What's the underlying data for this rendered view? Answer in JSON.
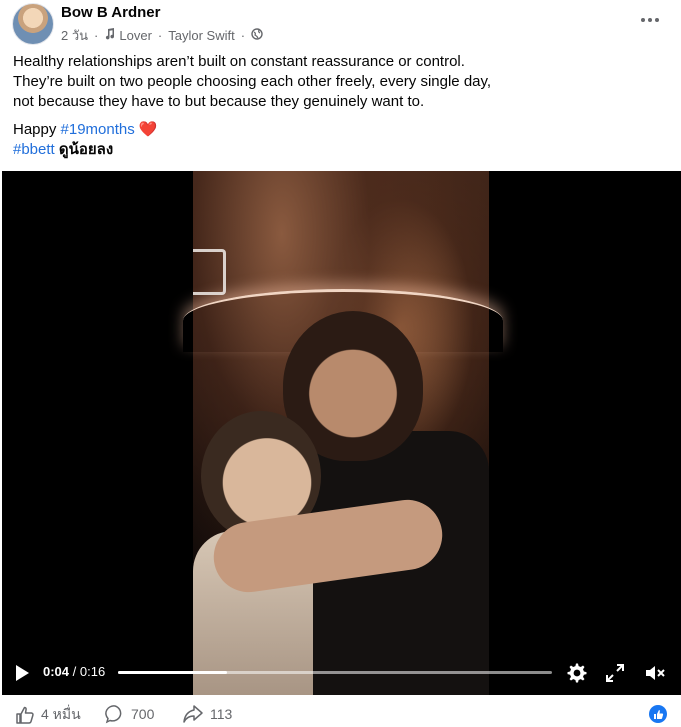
{
  "post": {
    "author": "Bow B Ardner",
    "time": "2 วัน",
    "song": "Lover",
    "artist": "Taylor Swift",
    "caption_lines": [
      "Healthy relationships aren’t built on constant reassurance or control.",
      "They’re built on two people choosing each other freely, every single day,",
      "not because they have to but because they genuinely want to."
    ],
    "happy_word": "Happy ",
    "hashtag_months": "#19months",
    "heart": "❤️",
    "hashtag_bbett": "#bbett",
    "thai_text": " ดูน้อยลง"
  },
  "video": {
    "current_time": "0:04",
    "separator": " / ",
    "duration": "0:16",
    "progress_fraction": 0.25
  },
  "footer": {
    "likes": "4 หมื่น",
    "comments": "700",
    "shares": "113"
  },
  "icons": {
    "more": "more-icon",
    "music": "music-note-icon",
    "globe": "globe-icon",
    "like": "thumbs-up-icon",
    "comment": "comment-icon",
    "share": "share-icon",
    "settings": "gear-icon",
    "fullscreen": "fullscreen-icon",
    "volume": "volume-muted-icon",
    "play": "play-icon"
  },
  "colors": {
    "hashtag": "#216fdb",
    "secondary_text": "#65676b",
    "brand": "#1877f2"
  }
}
